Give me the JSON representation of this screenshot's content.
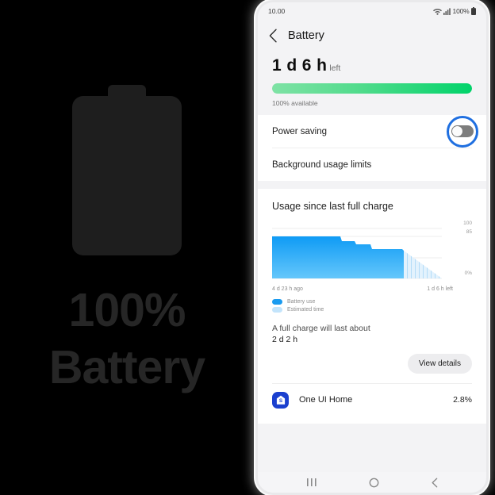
{
  "left_panel": {
    "icon": "battery-icon",
    "title_line1": "100%",
    "title_line2": "Battery"
  },
  "phone": {
    "status_bar": {
      "time": "10.00",
      "wifi_icon": "wifi-icon",
      "signal_icon": "signal-bars-icon",
      "battery_percent": "100%",
      "battery_icon": "battery-status-icon"
    },
    "app_bar": {
      "back_icon": "chevron-left-icon",
      "title": "Battery"
    },
    "summary": {
      "time_left_value": "1 d 6 h",
      "time_left_unit": "left",
      "progress_percent": 100,
      "progress_color_start": "#7fe2a5",
      "progress_color_end": "#00d36a",
      "available_label": "100% available"
    },
    "settings_rows": [
      {
        "label": "Power saving",
        "control": "toggle",
        "toggle_on": false,
        "highlighted": true
      },
      {
        "label": "Background usage limits",
        "control": "none"
      }
    ],
    "usage_card": {
      "title": "Usage since last full charge",
      "x_start_label": "4 d 23 h ago",
      "x_end_label": "1 d 6 h left",
      "legend": [
        {
          "label": "Battery use",
          "color": "#1a9bf0"
        },
        {
          "label": "Estimated time",
          "color": "#c3e4fb"
        }
      ],
      "full_charge_caption": "A full charge will last about",
      "full_charge_value": "2 d 2 h",
      "view_details_label": "View details"
    },
    "app_list": [
      {
        "icon": "one-ui-home-icon",
        "name": "One UI Home",
        "percent": "2.8%"
      }
    ],
    "nav_bar": {
      "recents_icon": "recents-icon",
      "home_icon": "home-icon",
      "back_icon": "back-icon"
    }
  },
  "chart_data": {
    "type": "area",
    "title": "Usage since last full charge",
    "xlabel": "",
    "ylabel": "",
    "ylim": [
      0,
      100
    ],
    "ytick_labels": [
      "100",
      "85",
      "0%"
    ],
    "ytick_values": [
      100,
      85,
      0
    ],
    "grid": true,
    "legend_position": "bottom-left",
    "x_axis_labels": [
      "4 d 23 h ago",
      "1 d 6 h left"
    ],
    "series": [
      {
        "name": "Battery use",
        "color": "#1a9bf0",
        "x": [
          0,
          0.5,
          0.52,
          0.56,
          0.6,
          0.64,
          0.7,
          0.8,
          0.84,
          1.0
        ],
        "values": [
          85,
          85,
          79,
          79,
          76,
          76,
          70,
          70,
          68,
          68
        ]
      },
      {
        "name": "Estimated time",
        "color": "#c3e4fb",
        "pattern": "hatched",
        "x": [
          1.0,
          1.55
        ],
        "values": [
          68,
          0
        ]
      }
    ]
  }
}
